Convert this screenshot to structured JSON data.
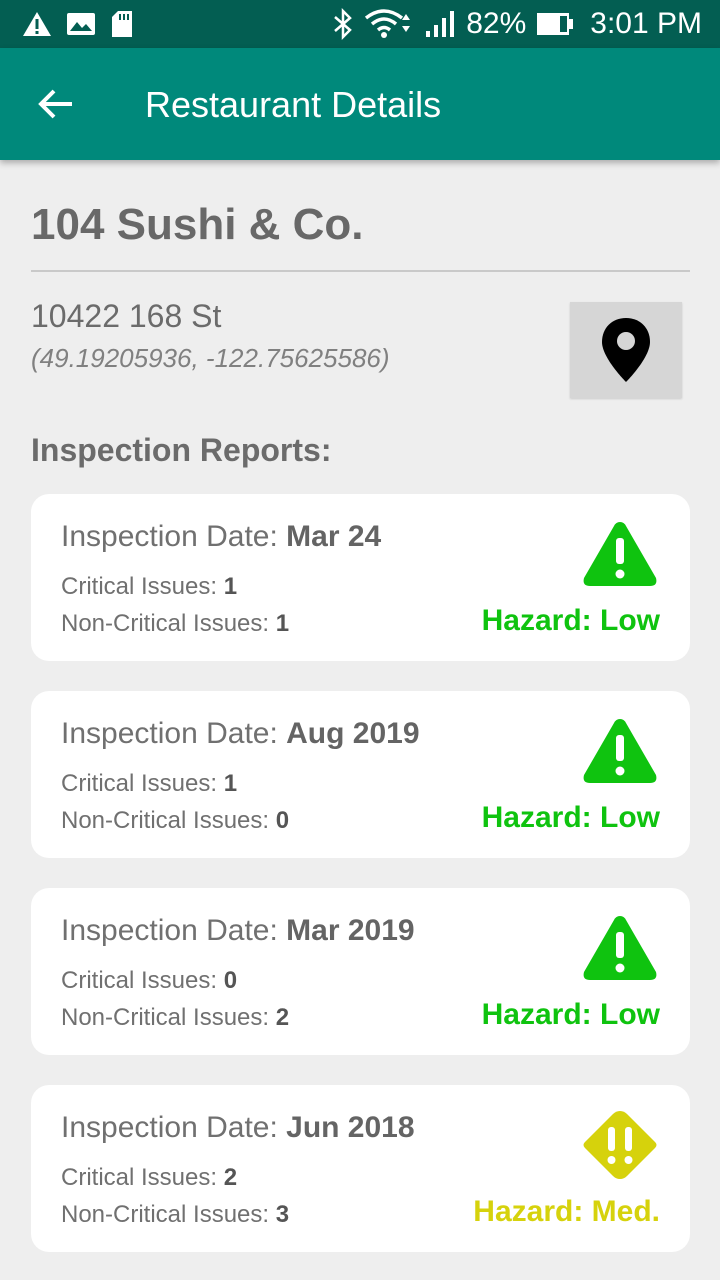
{
  "status_bar": {
    "battery": "82%",
    "time": "3:01 PM",
    "icons": [
      "warning-icon",
      "image-icon",
      "sd-card-icon",
      "bluetooth-icon",
      "wifi-icon",
      "signal-icon",
      "battery-icon"
    ]
  },
  "app_bar": {
    "title": "Restaurant Details",
    "back_icon": "arrow-back-icon"
  },
  "restaurant": {
    "name": "104 Sushi & Co.",
    "address": "10422 168 St",
    "coordinates": "(49.19205936, -122.75625586)",
    "map_icon": "map-pin-icon"
  },
  "section_title": "Inspection Reports:",
  "labels": {
    "date": "Inspection Date: ",
    "critical": "Critical Issues: ",
    "non_critical": "Non-Critical Issues: "
  },
  "inspections": [
    {
      "date": "Mar 24",
      "critical": "1",
      "non_critical": "1",
      "hazard": "Hazard: Low",
      "level": "low",
      "color": "#0fc30f"
    },
    {
      "date": "Aug 2019",
      "critical": "1",
      "non_critical": "0",
      "hazard": "Hazard: Low",
      "level": "low",
      "color": "#0fc30f"
    },
    {
      "date": "Mar 2019",
      "critical": "0",
      "non_critical": "2",
      "hazard": "Hazard: Low",
      "level": "low",
      "color": "#0fc30f"
    },
    {
      "date": "Jun 2018",
      "critical": "2",
      "non_critical": "3",
      "hazard": "Hazard: Med.",
      "level": "medium",
      "color": "#d6d20c"
    }
  ],
  "colors": {
    "primary": "#00897b",
    "primary_dark": "#035e52",
    "hazard_low": "#0fc30f",
    "hazard_medium": "#d6d20c"
  }
}
